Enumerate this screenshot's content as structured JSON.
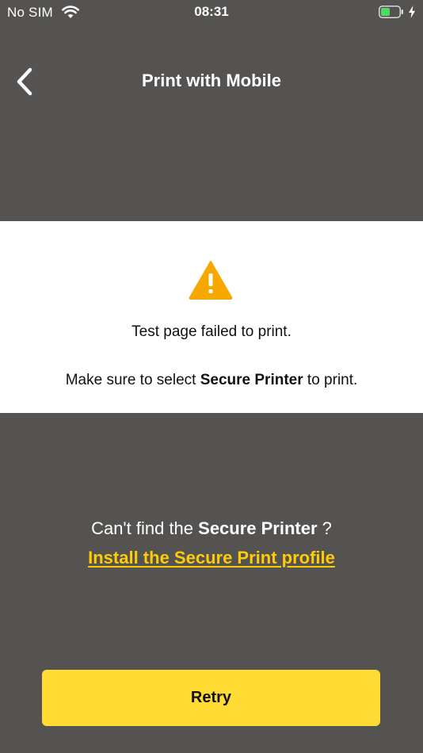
{
  "status_bar": {
    "carrier": "No SIM",
    "time": "08:31"
  },
  "nav": {
    "back_icon": "chevron-left-icon",
    "title": "Print with Mobile"
  },
  "status_card": {
    "icon": "warning-icon",
    "title": "Test page failed to print.",
    "instruction_prefix": "Make sure to select ",
    "instruction_bold": "Secure Printer",
    "instruction_suffix": " to print."
  },
  "help": {
    "prefix": "Can't find the ",
    "bold": "Secure Printer",
    "suffix": " ?",
    "link_label": "Install the Secure Print profile"
  },
  "retry": {
    "label": "Retry"
  },
  "colors": {
    "background": "#545351",
    "accent_yellow": "#ffcb05",
    "button_yellow": "#ffdb33",
    "warning_orange": "#f7a800",
    "battery_green": "#4cd964"
  }
}
